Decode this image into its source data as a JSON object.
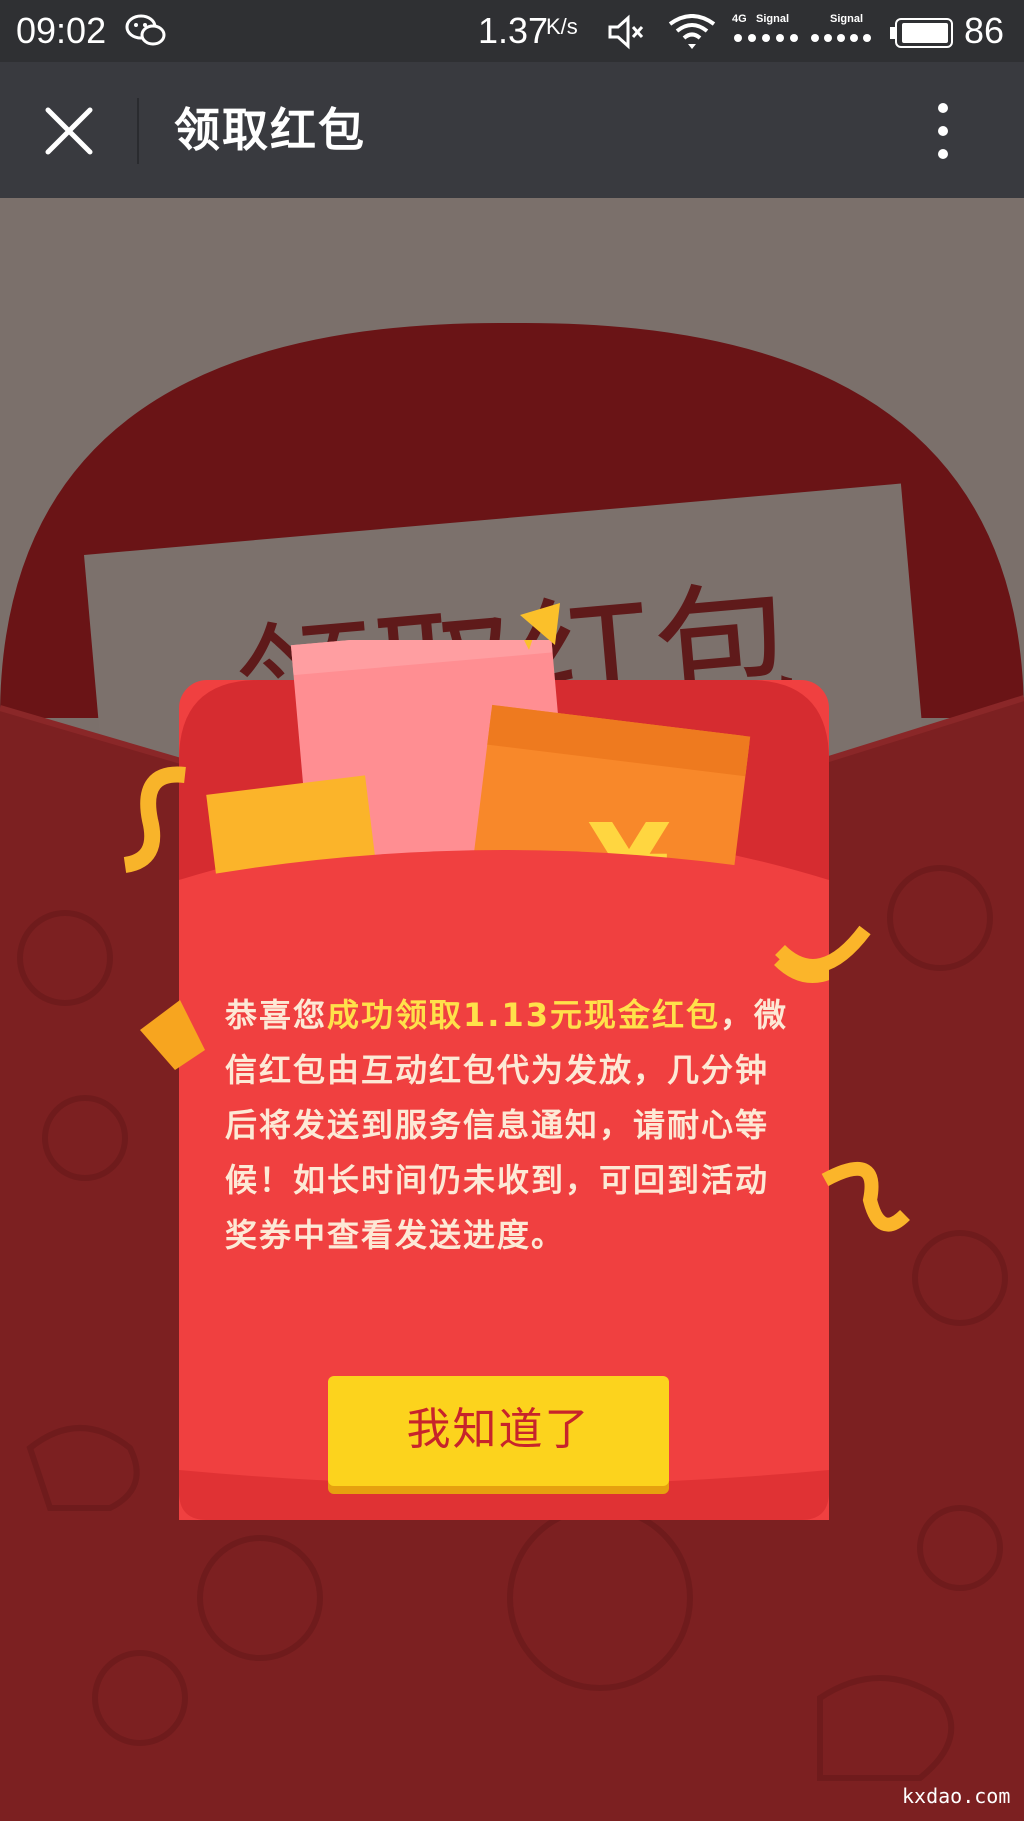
{
  "status_bar": {
    "time": "09:02",
    "net_speed": "1.37",
    "net_speed_unit": "K/s",
    "signal1_label": "Signal",
    "signal1_type": "4G",
    "signal2_label": "Signal",
    "battery": "86"
  },
  "nav": {
    "title": "领取红包"
  },
  "background": {
    "card_text": "领取红包"
  },
  "modal": {
    "message_prefix": "恭喜您",
    "message_highlight": "成功领取1.13元现金红包",
    "message_rest": "，微信红包由互动红包代为发放，几分钟后将发送到服务信息通知，请耐心等候！如长时间仍未收到，可回到活动奖券中查看发送进度。",
    "ok_button": "我知道了"
  },
  "watermark": "kxdao.com",
  "colors": {
    "status_bar": "#2f3033",
    "nav_bar": "#393a3f",
    "envelope_dark": "#7c2021",
    "modal_red": "#f04040",
    "button_yellow": "#fcd31d",
    "highlight_yellow": "#ffe14a"
  }
}
